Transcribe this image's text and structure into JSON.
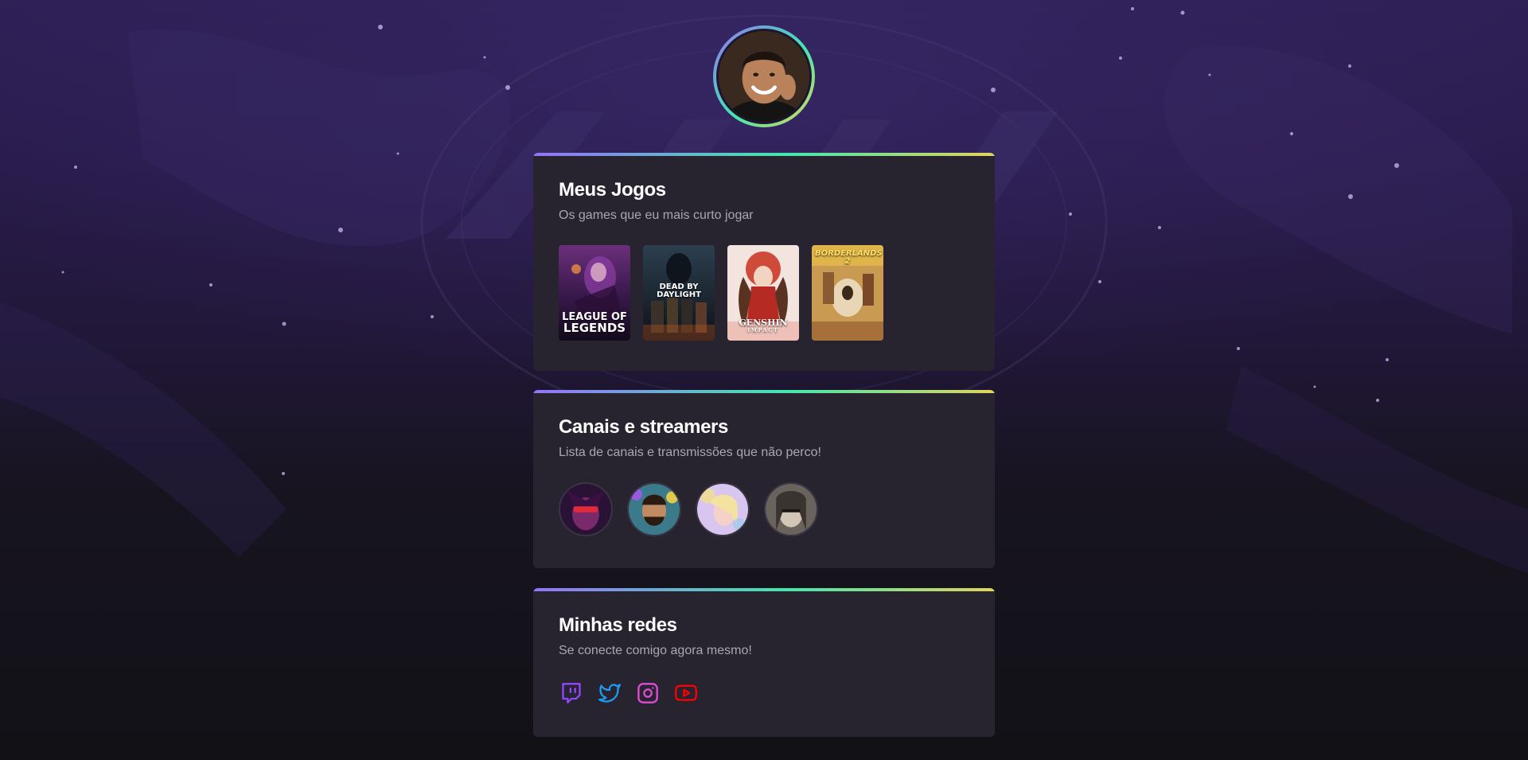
{
  "profile": {
    "avatar_alt": ""
  },
  "games_card": {
    "title": "Meus Jogos",
    "subtitle": "Os games que eu mais curto jogar",
    "games": [
      {
        "label_line1": "LEAGUE OF",
        "label_line2": "LEGENDS"
      },
      {
        "label_line1": "DEAD BY",
        "label_line2": "DAYLIGHT"
      },
      {
        "label_line1": "GENSHIN",
        "label_line2": "IMPACT"
      },
      {
        "label_line1": "BORDERLANDS 2",
        "label_line2": ""
      }
    ]
  },
  "channels_card": {
    "title": "Canais e streamers",
    "subtitle": "Lista de canais e transmissões que não perco!"
  },
  "socials_card": {
    "title": "Minhas redes",
    "subtitle": "Se conecte comigo agora mesmo!",
    "icons": [
      "twitch-icon",
      "twitter-icon",
      "instagram-icon",
      "youtube-icon"
    ]
  },
  "colors": {
    "gradient_start": "#9572fc",
    "gradient_mid": "#43e7ad",
    "gradient_end": "#e2d45c",
    "card_bg": "#27232f",
    "subtitle_text": "#a8a8b3",
    "twitch": "#9146ff",
    "twitter": "#1d9bf0",
    "instagram": "#e04bd6",
    "youtube": "#ff0000"
  }
}
